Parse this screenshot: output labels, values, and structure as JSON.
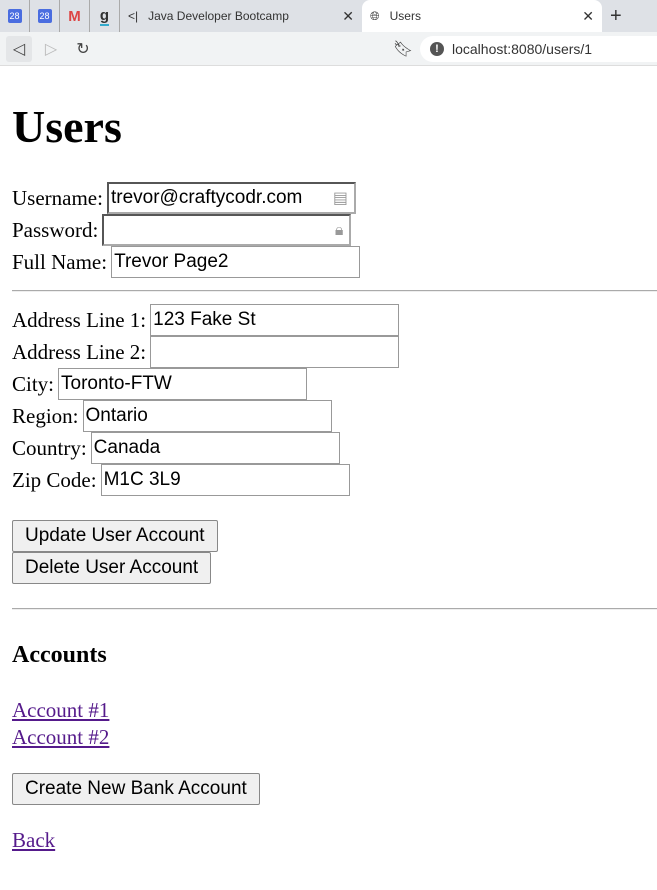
{
  "browser": {
    "pinned_tabs": [
      {
        "icon": "calendar-icon",
        "label": "28"
      },
      {
        "icon": "calendar-icon",
        "label": "28"
      },
      {
        "icon": "gmail-icon",
        "label": "M"
      },
      {
        "icon": "app-icon",
        "label": "g"
      }
    ],
    "tabs": [
      {
        "label": "Java Developer Bootcamp",
        "icon": "code-icon",
        "active": false
      },
      {
        "label": "Users",
        "icon": "globe-icon",
        "active": true
      }
    ],
    "url": "localhost:8080/users/1"
  },
  "page": {
    "title": "Users",
    "fields": {
      "username": {
        "label": "Username:",
        "value": "trevor@craftycodr.com"
      },
      "password": {
        "label": "Password:",
        "value": ""
      },
      "full_name": {
        "label": "Full Name:",
        "value": "Trevor Page2"
      },
      "address1": {
        "label": "Address Line 1:",
        "value": "123 Fake St"
      },
      "address2": {
        "label": "Address Line 2:",
        "value": ""
      },
      "city": {
        "label": "City:",
        "value": "Toronto-FTW"
      },
      "region": {
        "label": "Region:",
        "value": "Ontario"
      },
      "country": {
        "label": "Country:",
        "value": "Canada"
      },
      "zip": {
        "label": "Zip Code:",
        "value": "M1C 3L9"
      }
    },
    "update_button": "Update User Account",
    "delete_button": "Delete User Account",
    "accounts_heading": "Accounts",
    "accounts": [
      "Account #1",
      "Account #2"
    ],
    "create_button": "Create New Bank Account",
    "back_link": "Back"
  }
}
